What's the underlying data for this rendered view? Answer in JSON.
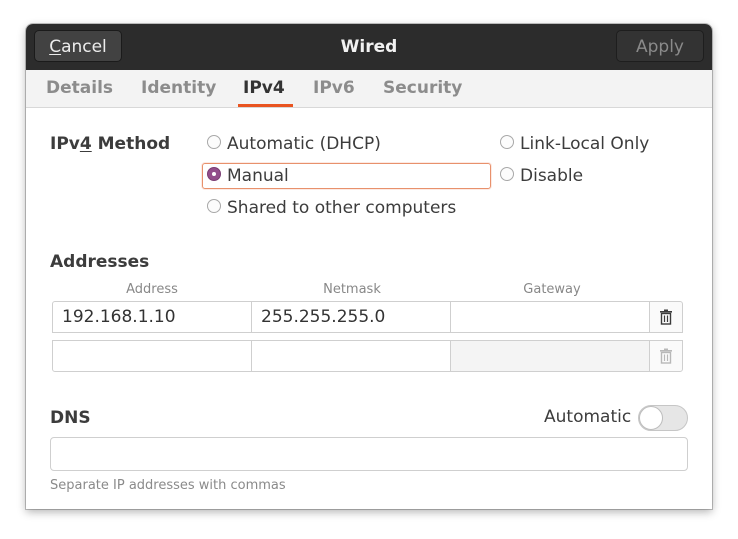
{
  "header": {
    "cancel_label_mnemonic": "C",
    "cancel_label_rest": "ancel",
    "title": "Wired",
    "apply_label": "Apply"
  },
  "tabs": [
    {
      "label": "Details"
    },
    {
      "label": "Identity"
    },
    {
      "label": "IPv4"
    },
    {
      "label": "IPv6"
    },
    {
      "label": "Security"
    }
  ],
  "active_tab": "IPv4",
  "ipv4_method": {
    "label_pre": "IPv",
    "label_mnemonic": "4",
    "label_post": " Method",
    "options": [
      {
        "label": "Automatic (DHCP)",
        "checked": false
      },
      {
        "label": "Link-Local Only",
        "checked": false
      },
      {
        "label": "Manual",
        "checked": true
      },
      {
        "label": "Disable",
        "checked": false
      },
      {
        "label": "Shared to other computers",
        "checked": false
      }
    ]
  },
  "addresses": {
    "title": "Addresses",
    "columns": [
      "Address",
      "Netmask",
      "Gateway"
    ],
    "rows": [
      {
        "address": "192.168.1.10",
        "netmask": "255.255.255.0",
        "gateway": ""
      },
      {
        "address": "",
        "netmask": "",
        "gateway": ""
      }
    ]
  },
  "dns": {
    "title": "DNS",
    "automatic_label": "Automatic",
    "automatic_on": false,
    "value": "",
    "hint": "Separate IP addresses with commas"
  },
  "colors": {
    "accent": "#e95420",
    "radio_checked": "#924d8b",
    "header_bg": "#2c2c2c"
  }
}
